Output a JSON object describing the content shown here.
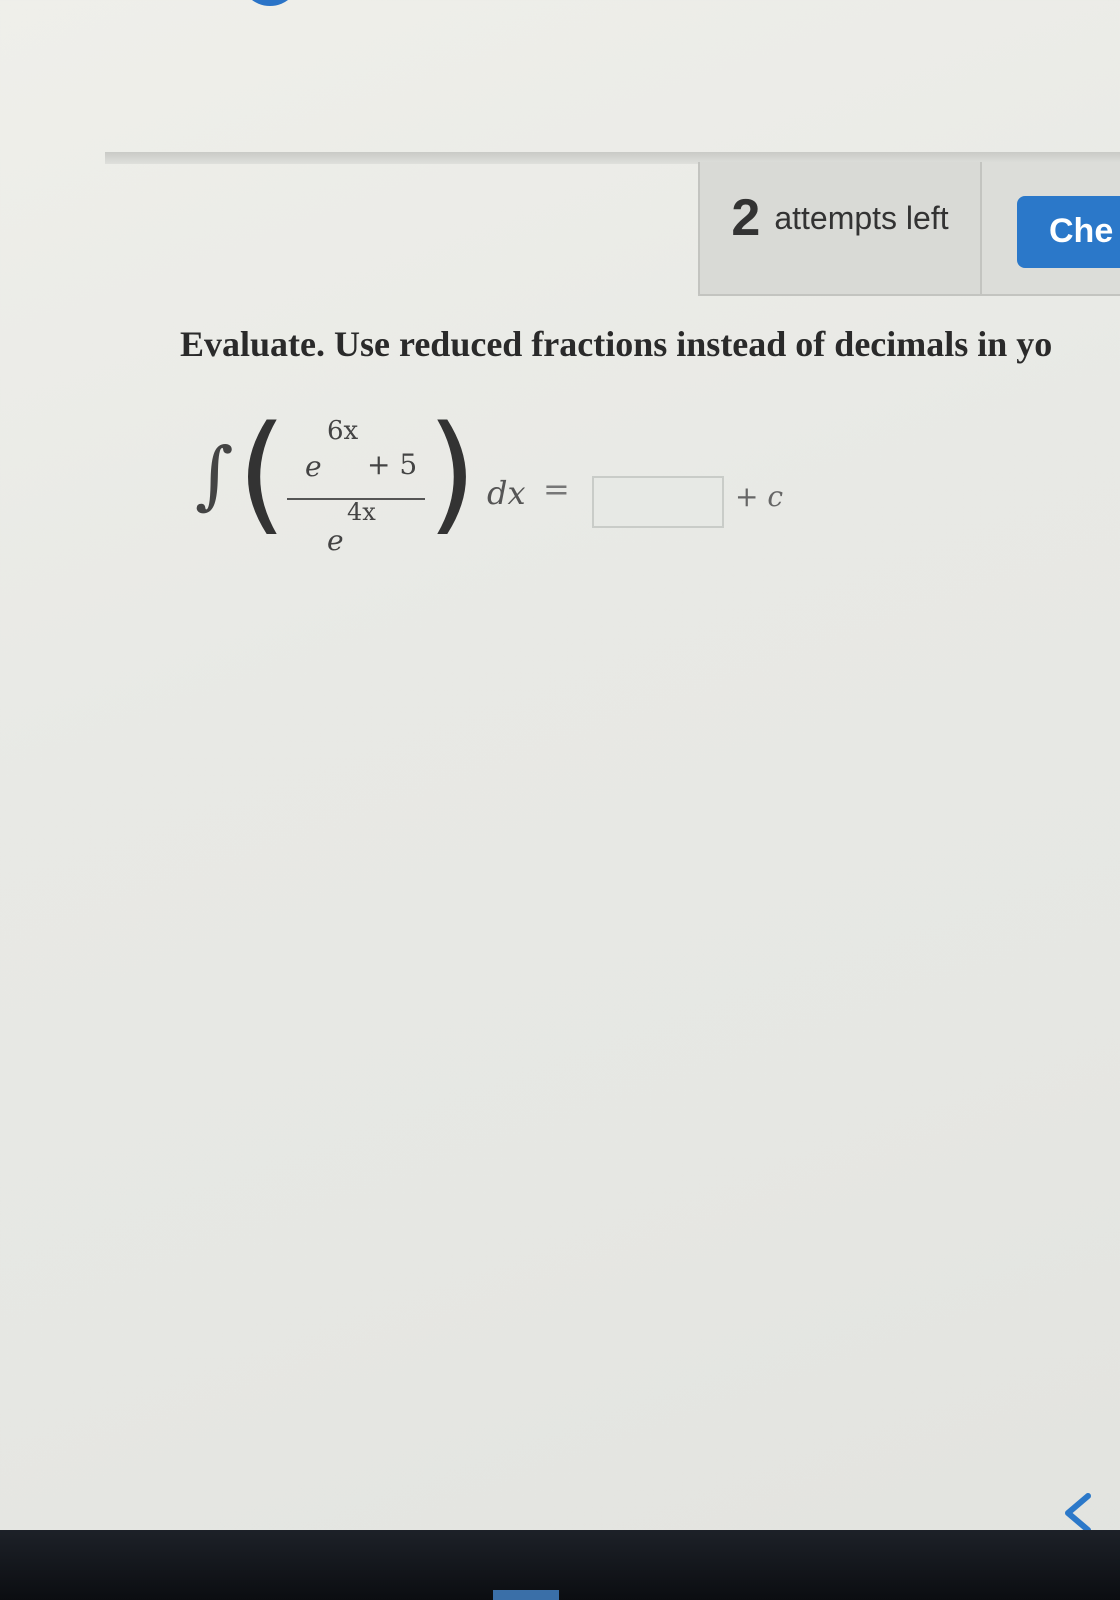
{
  "attempts": {
    "count": "2",
    "label": "attempts left"
  },
  "check_button": {
    "label": "Che"
  },
  "question": {
    "instructions": "Evaluate. Use reduced fractions instead of decimals in yo"
  },
  "integral": {
    "sign": "∫",
    "left_paren": "(",
    "right_paren": ")",
    "numerator_base": "e",
    "numerator_exponent": "6x",
    "numerator_addend": "+ 5",
    "denominator_base": "e",
    "denominator_exponent": "4x",
    "differential": "dx",
    "equals": "=",
    "answer_value": "",
    "constant": "+ c"
  },
  "icons": {
    "back": "chevron-left-icon"
  },
  "colors": {
    "accent": "#2b78c9",
    "background": "#e8e9e5",
    "panel": "#d9dad6"
  }
}
